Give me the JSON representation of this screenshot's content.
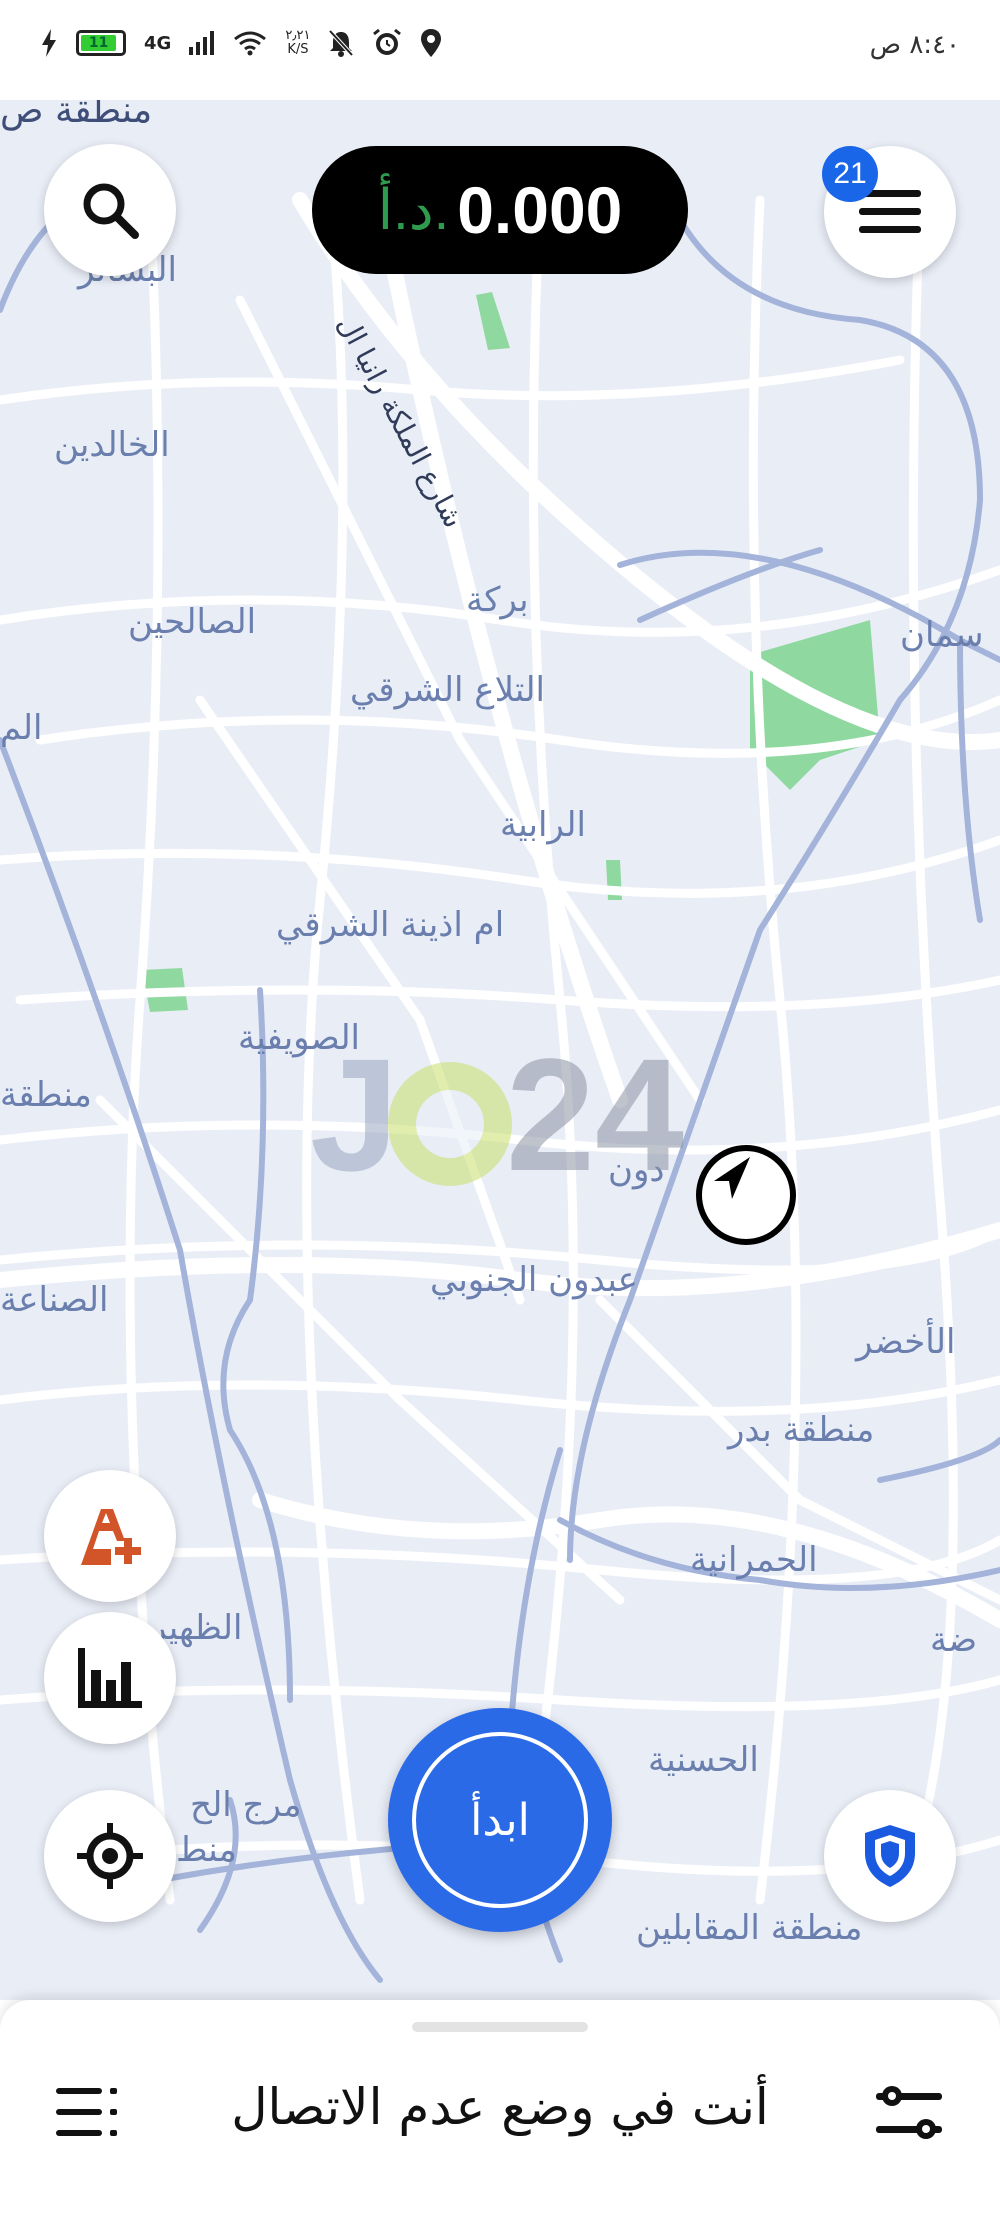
{
  "status_bar": {
    "time": "٨:٤٠ ص",
    "battery": "11",
    "network": "4G",
    "speed": "٢٫٢١\nK/S"
  },
  "earnings": {
    "amount": "0.000",
    "currency": "د.أ."
  },
  "menu": {
    "notification_count": "21"
  },
  "go_button": {
    "label": "ابدأ"
  },
  "bottom_sheet": {
    "status": "أنت في وضع عدم الاتصال"
  },
  "watermark": "Jo24",
  "map": {
    "places": [
      "منطقة ص",
      "البشائر",
      "شارع الملكة رانيا ال",
      "الخالدين",
      "بركة",
      "الصالحين",
      "سمان",
      "التلاع الشرقي",
      "الم",
      "الرابية",
      "ام اذينة الشرقي",
      "الصويفية",
      "منطقة",
      "دون",
      "عبدون الجنوبي",
      "الصناعة",
      "الأخضر",
      "منطقة بدر",
      "الحمرانية",
      "الظهير",
      "ضة",
      "الحسنية",
      "مرج الح",
      "منط",
      "منطقة المقابلين"
    ]
  },
  "colors": {
    "map_bg": "#e9edf6",
    "road": "#ffffff",
    "highway": "#a3b3d9",
    "park": "#8fd9a0",
    "label": "#6a7fae",
    "go_button": "#2b6ae6",
    "badge": "#1a66e8"
  },
  "icons": {
    "search": "search-icon",
    "menu": "hamburger-menu-icon",
    "boost": "a-plus-icon",
    "stats": "bar-chart-icon",
    "locate": "crosshair-icon",
    "safety": "shield-icon",
    "navigation": "navigation-arrow-icon",
    "list": "list-icon",
    "preferences": "sliders-icon"
  }
}
